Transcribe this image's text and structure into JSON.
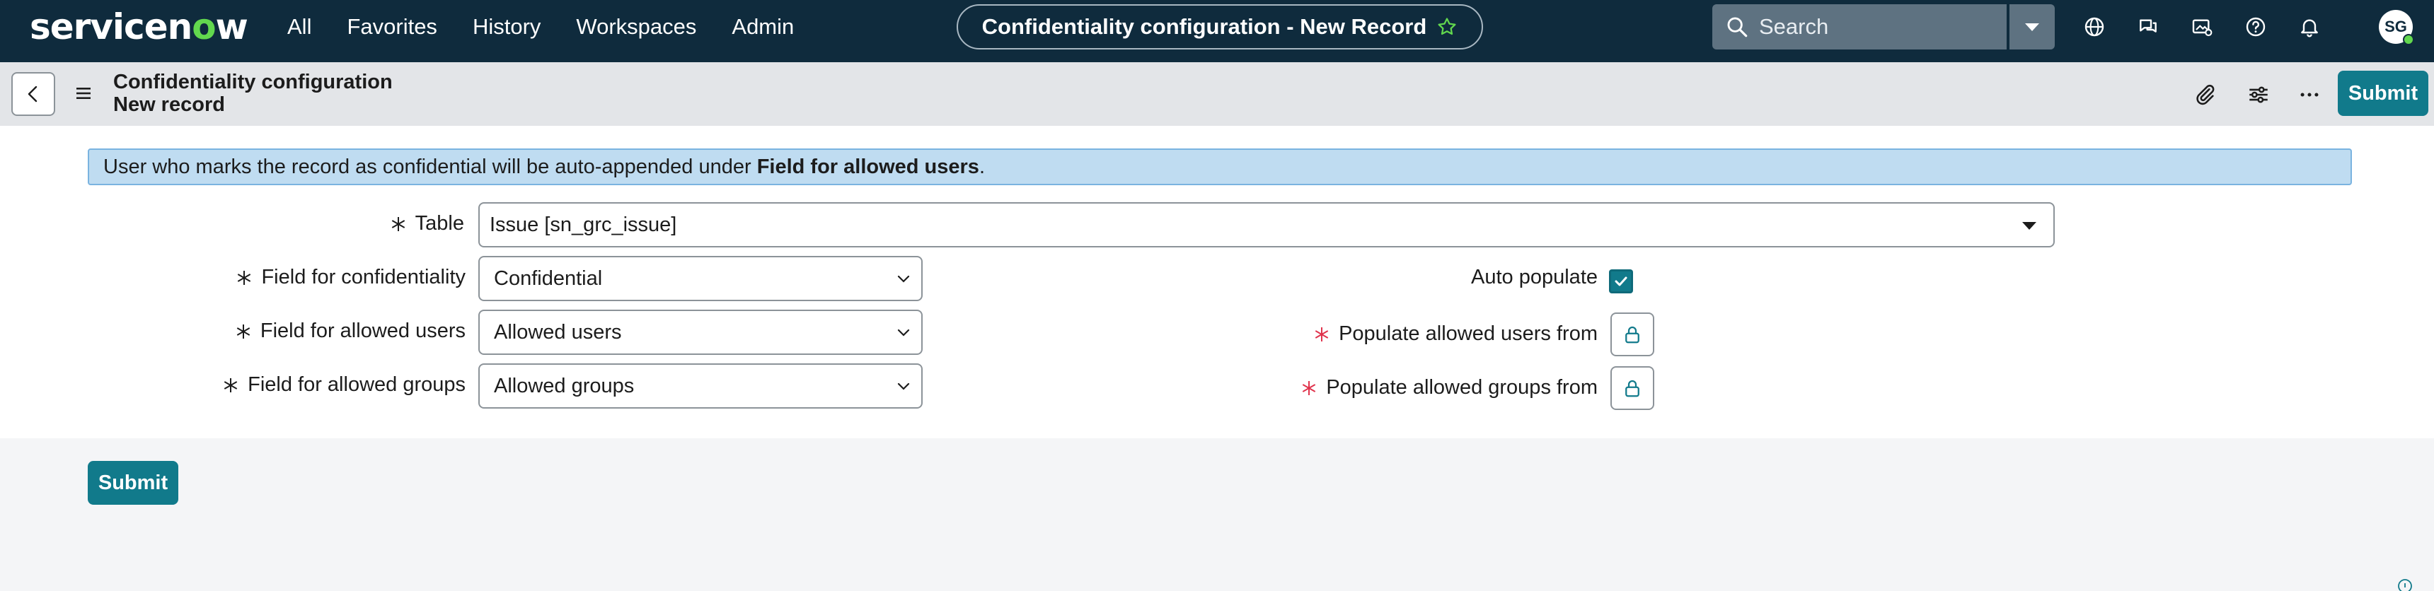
{
  "topnav": {
    "logo": "servicenow",
    "menu": [
      "All",
      "Favorites",
      "History",
      "Workspaces",
      "Admin"
    ],
    "record_title": "Confidentiality configuration - New Record",
    "search_placeholder": "Search",
    "avatar_initials": "SG",
    "icons": [
      "globe-icon",
      "chat-icon",
      "media-icon",
      "help-icon",
      "bell-icon"
    ]
  },
  "formbar": {
    "title_line1": "Confidentiality configuration",
    "title_line2": "New record",
    "submit_label": "Submit",
    "icons": [
      "paperclip-icon",
      "sliders-icon",
      "more-icon"
    ]
  },
  "banner": {
    "text_before": "User who marks the record as confidential will be auto-appended under ",
    "text_bold": "Field for allowed users",
    "text_after": "."
  },
  "fields": {
    "table": {
      "label": "Table",
      "value": "Issue [sn_grc_issue]"
    },
    "confidentiality": {
      "label": "Field for confidentiality",
      "value": "Confidential"
    },
    "allowed_users": {
      "label": "Field for allowed users",
      "value": "Allowed users"
    },
    "allowed_groups": {
      "label": "Field for allowed groups",
      "value": "Allowed groups"
    },
    "auto_populate": {
      "label": "Auto populate",
      "checked": true
    },
    "populate_users_from": {
      "label": "Populate allowed users from"
    },
    "populate_groups_from": {
      "label": "Populate allowed groups from"
    }
  },
  "bottom": {
    "submit_label": "Submit"
  },
  "colors": {
    "nav_bg": "#0f2b3d",
    "accent": "#117a8b",
    "banner_bg": "#bfdcf1",
    "required_red": "#e0334c",
    "brand_green": "#62d84e"
  }
}
